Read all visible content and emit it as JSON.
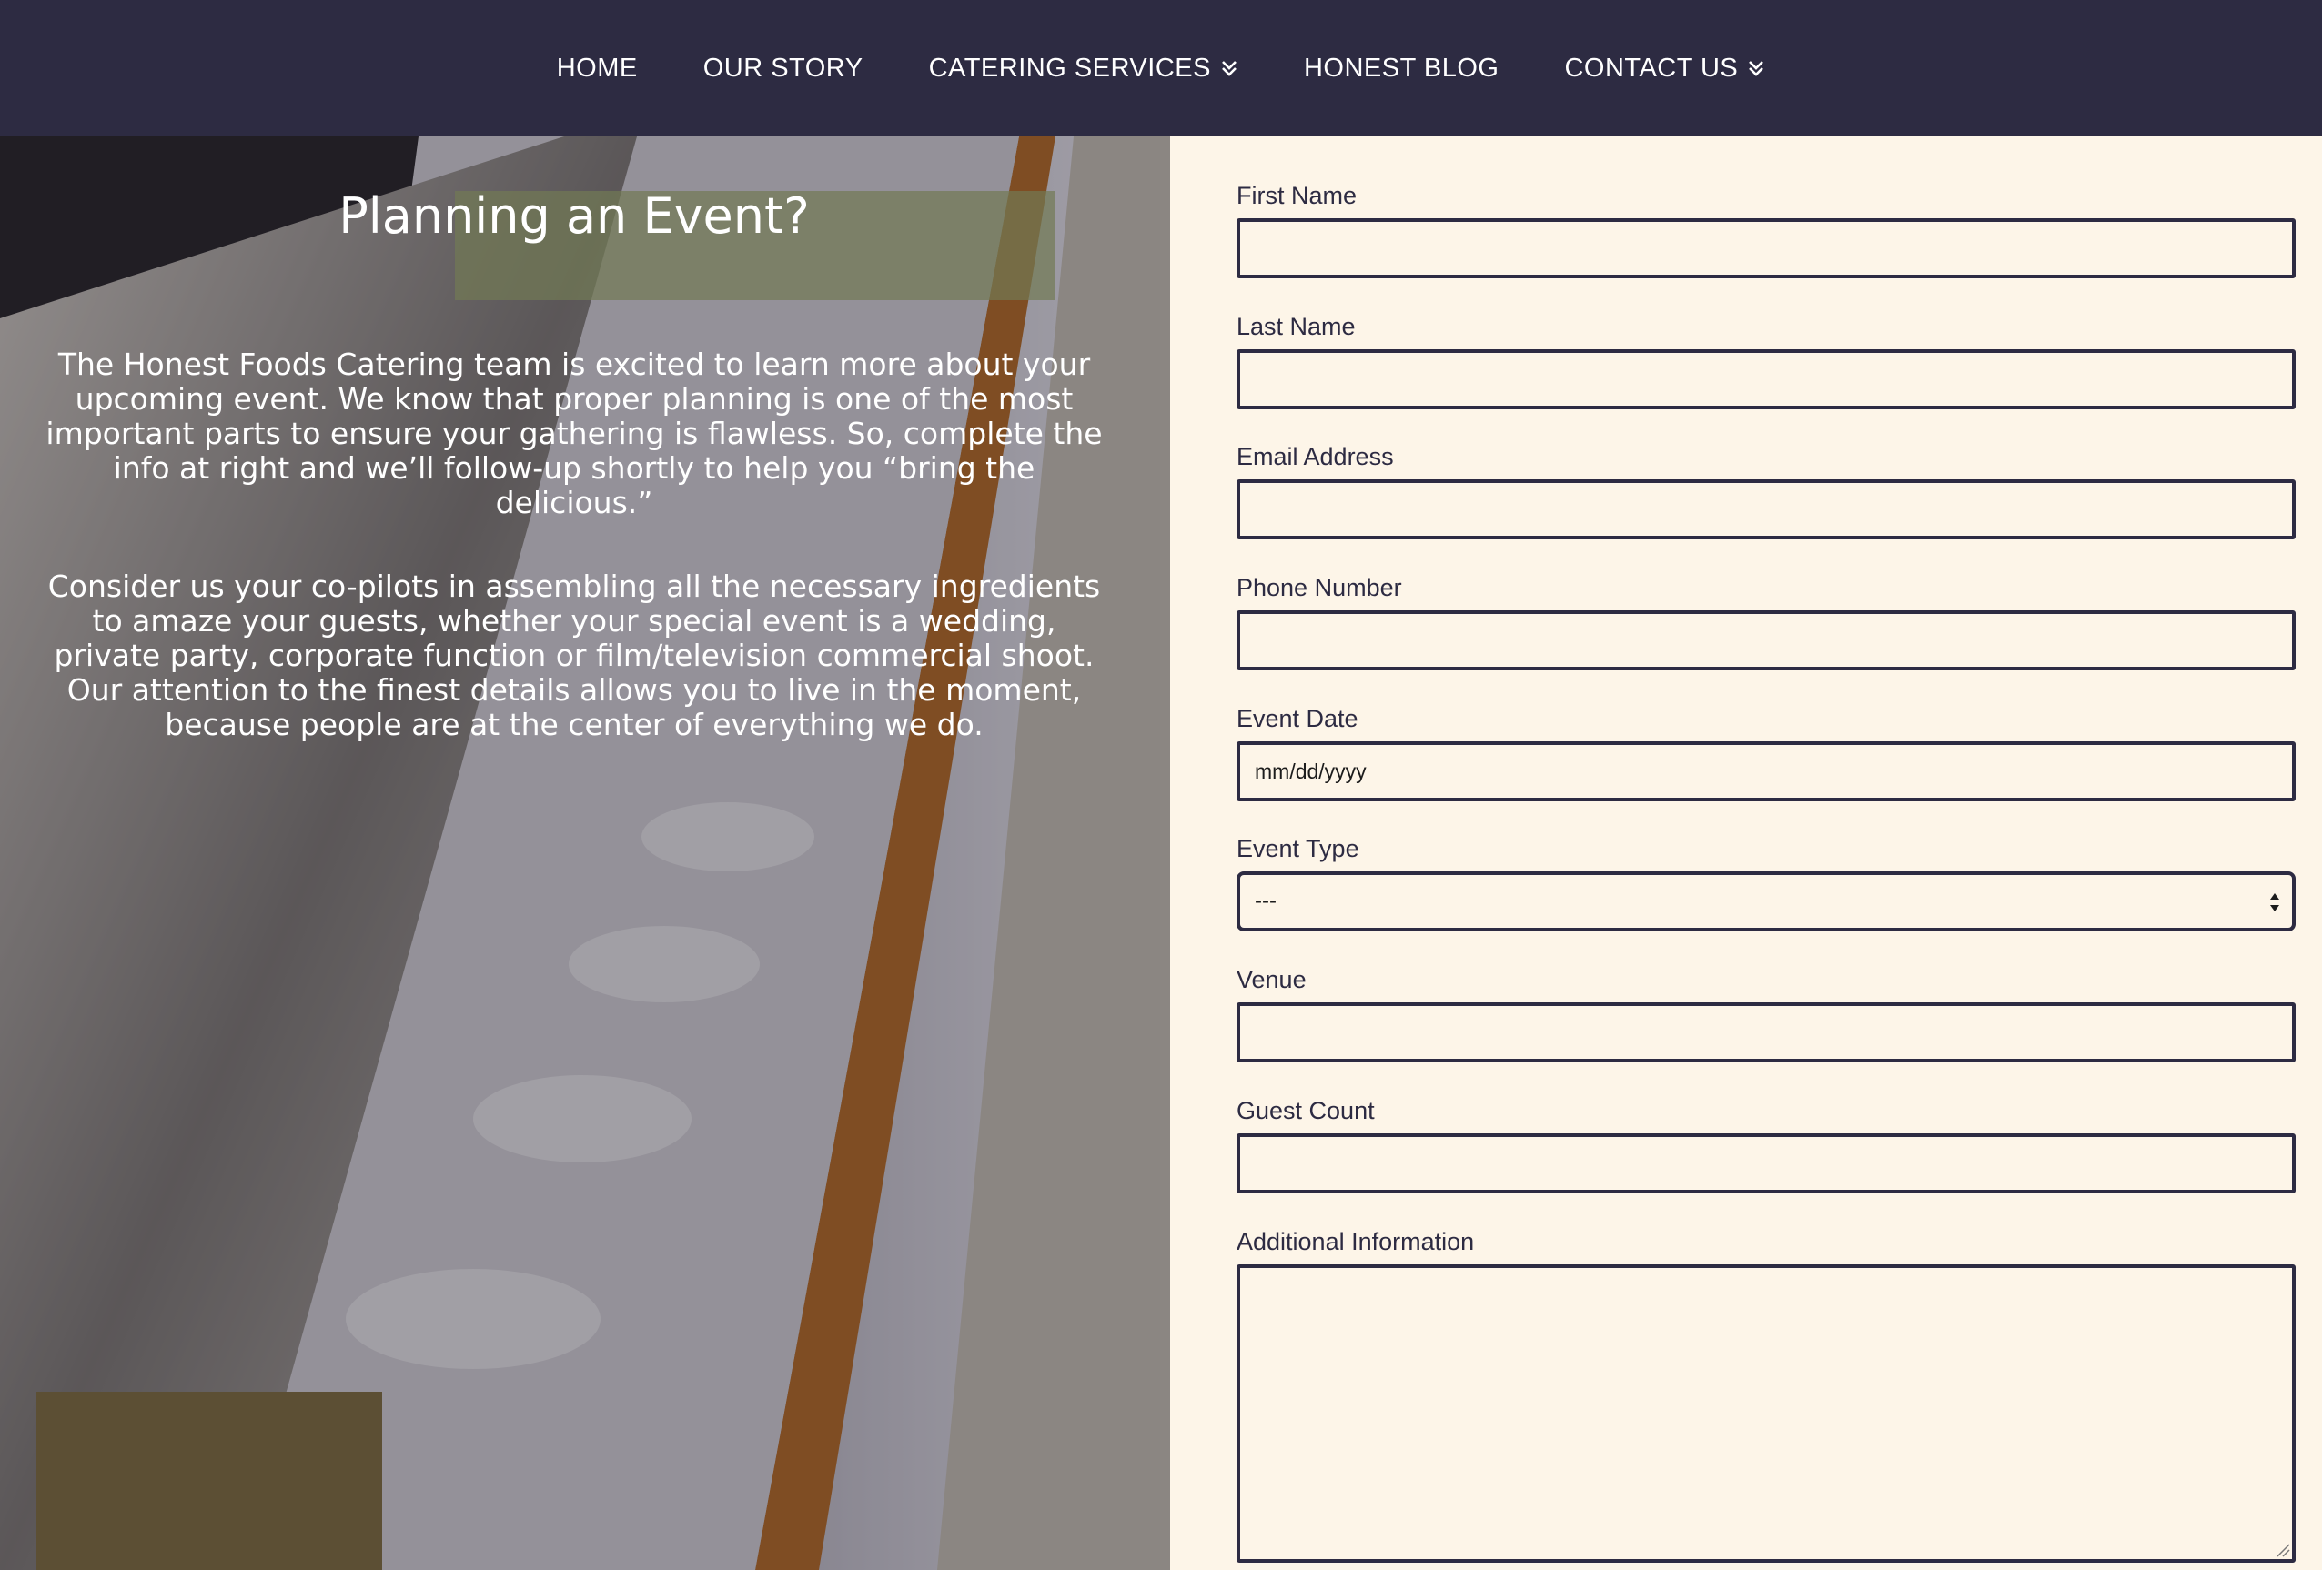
{
  "nav": {
    "items": [
      {
        "label": "HOME",
        "has_dropdown": false
      },
      {
        "label": "OUR STORY",
        "has_dropdown": false
      },
      {
        "label": "CATERING SERVICES",
        "has_dropdown": true
      },
      {
        "label": "HONEST BLOG",
        "has_dropdown": false
      },
      {
        "label": "CONTACT US",
        "has_dropdown": true
      }
    ]
  },
  "hero": {
    "title": "Planning an Event?",
    "paragraph1": "The Honest Foods Catering team is excited to learn more about your upcoming event. We know that proper planning is one of the most important parts to ensure your gathering is flawless. So, complete the info at right and we’ll follow-up shortly to help you “bring the delicious.”",
    "paragraph2": "Consider us your co-pilots in assembling all the necessary ingredients to amaze your guests, whether your special event is a wedding, private party, corporate function or film/television commercial shoot. Our attention to the finest details allows you to live in the moment, because people are at the center of everything we do."
  },
  "form": {
    "first_name": {
      "label": "First Name",
      "value": ""
    },
    "last_name": {
      "label": "Last Name",
      "value": ""
    },
    "email": {
      "label": "Email Address",
      "value": ""
    },
    "phone": {
      "label": "Phone Number",
      "value": ""
    },
    "event_date": {
      "label": "Event Date",
      "placeholder": "mm/dd/yyyy"
    },
    "event_type": {
      "label": "Event Type",
      "selected": "---"
    },
    "venue": {
      "label": "Venue",
      "value": ""
    },
    "guest_count": {
      "label": "Guest Count",
      "value": ""
    },
    "additional_info": {
      "label": "Additional Information",
      "value": ""
    }
  },
  "colors": {
    "nav_bg": "#2d2b42",
    "form_bg": "#fdf5e8",
    "field_border": "#2d2b42",
    "hero_text": "#ffffff"
  }
}
